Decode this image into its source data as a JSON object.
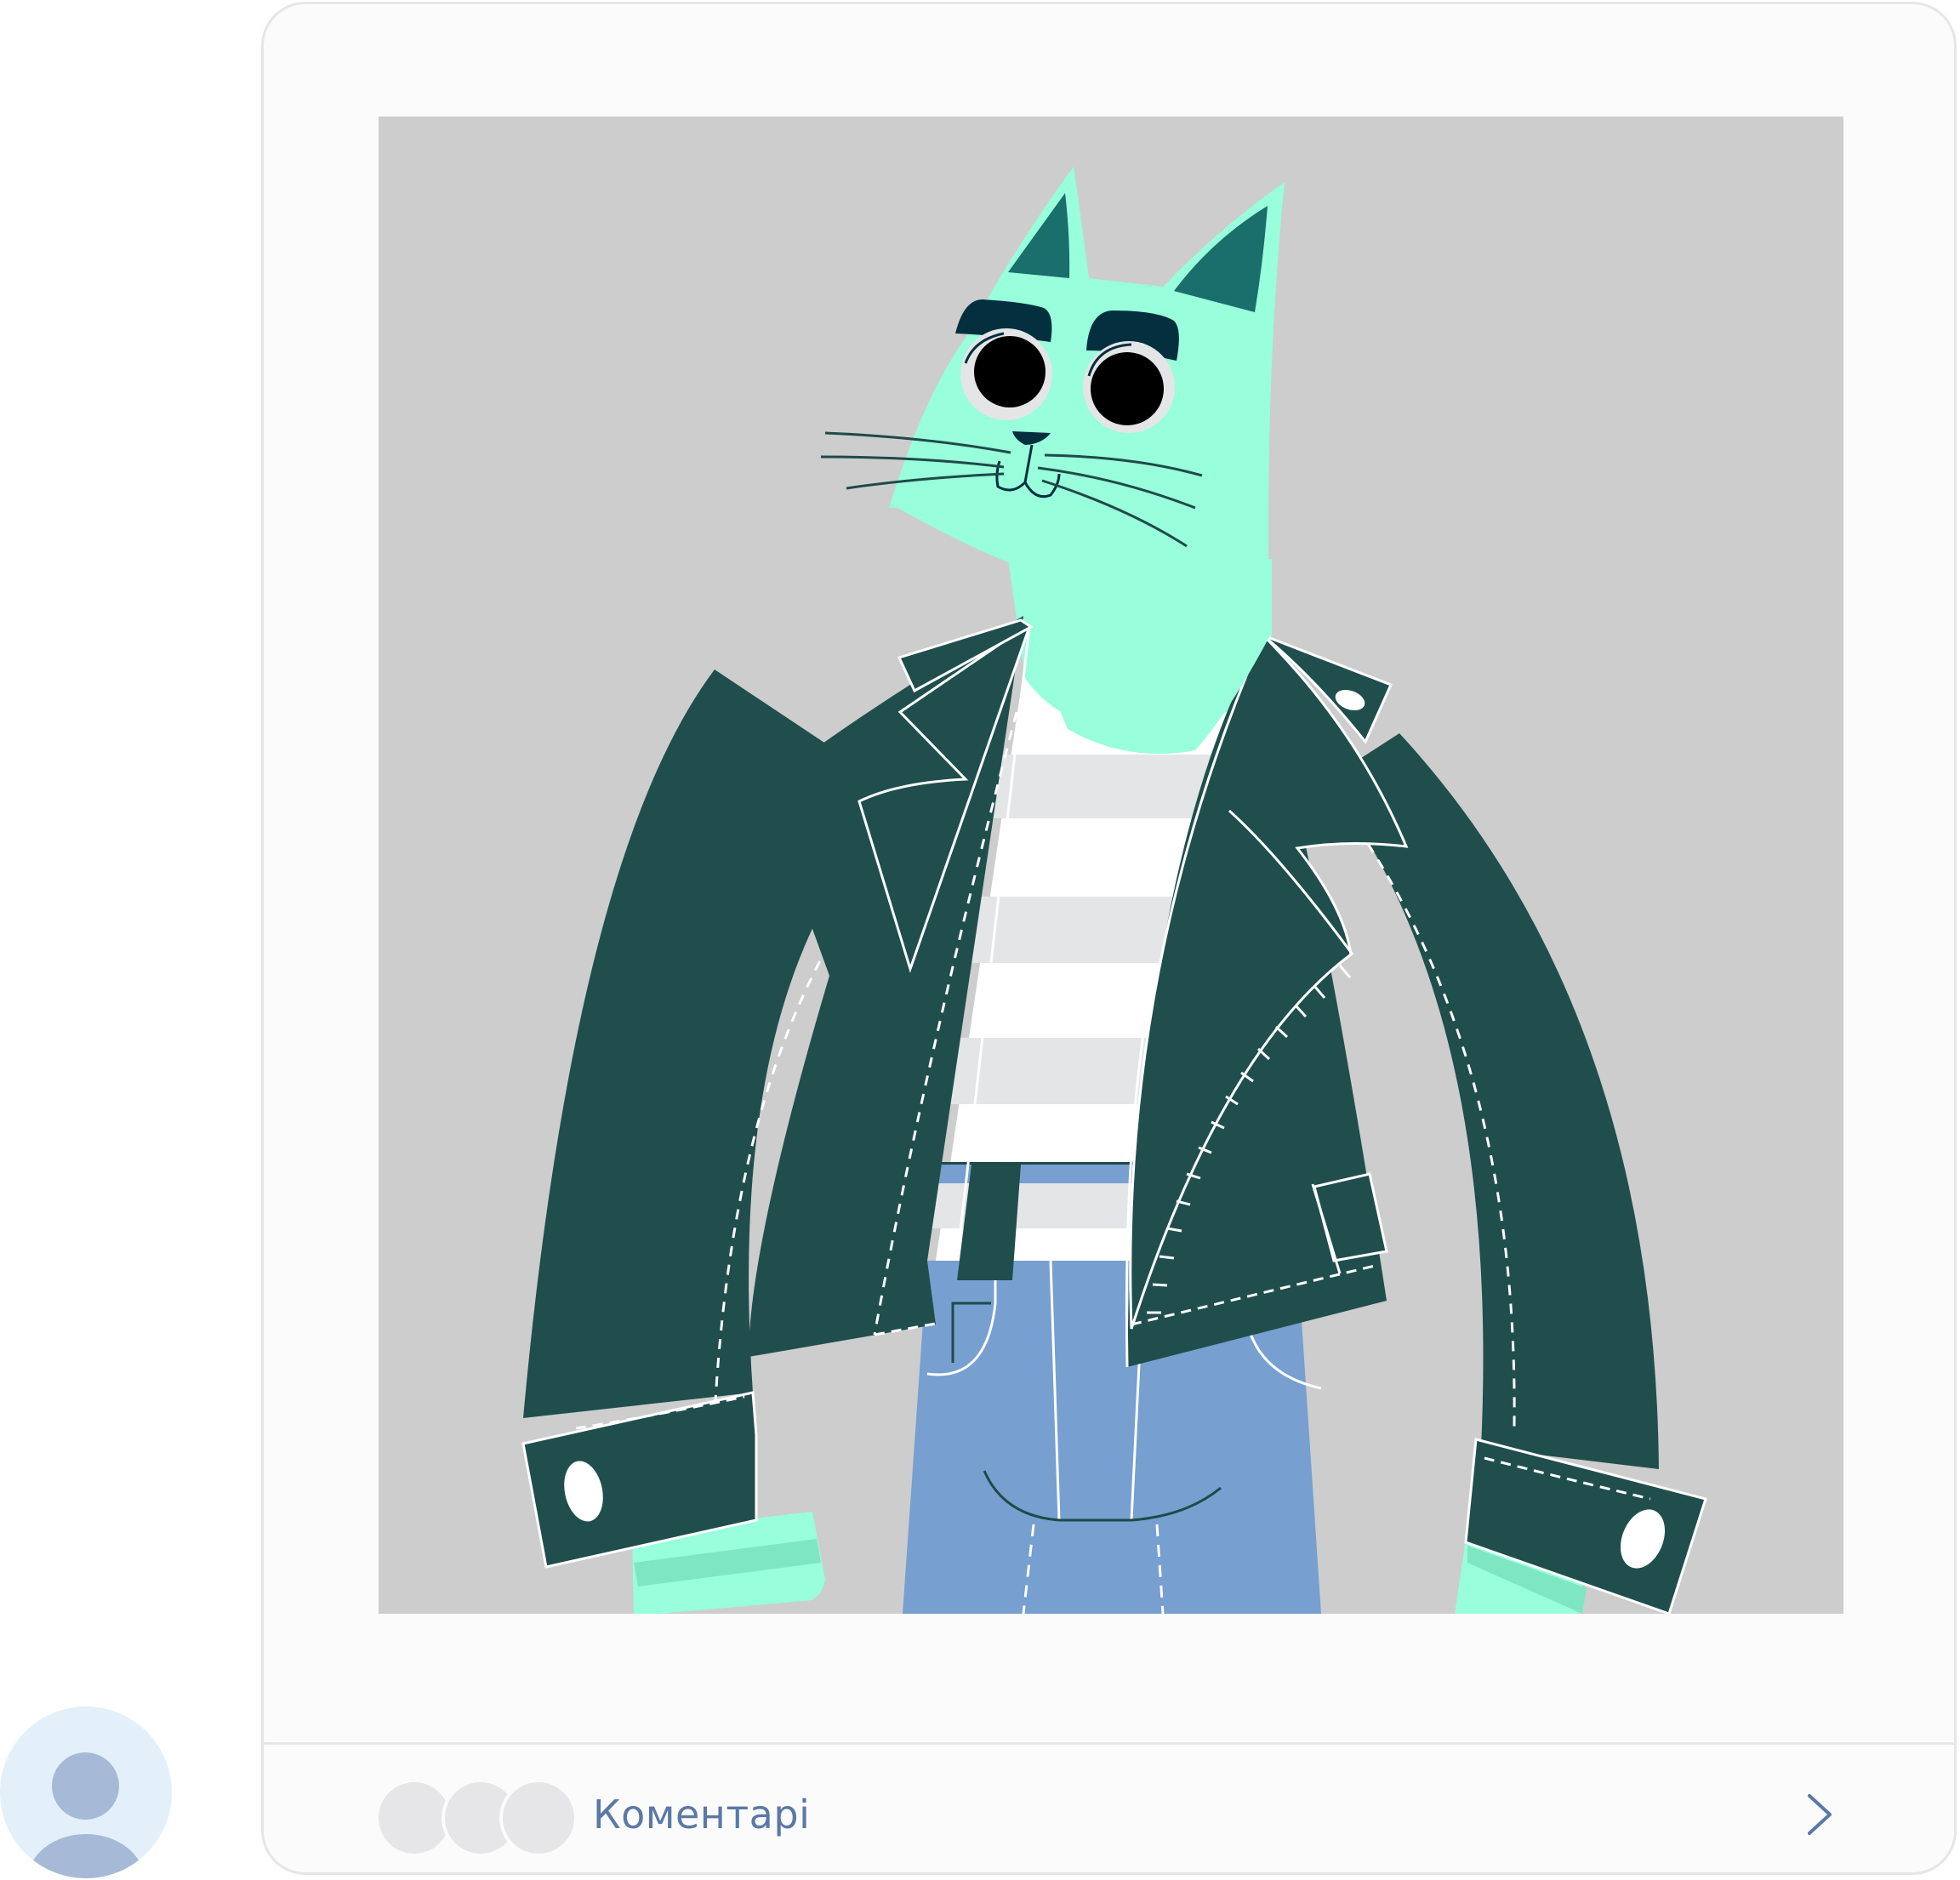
{
  "post": {
    "image_subject": "cat-in-leather-jacket-illustration"
  },
  "comments_bar": {
    "label": "Коментарі",
    "avatar_count": 3,
    "arrow_icon": "chevron-right-icon"
  },
  "profile": {
    "icon": "user-avatar-icon"
  },
  "colors": {
    "card_bg": "#fbfbfb",
    "card_border": "#e6e6e8",
    "photo_bg": "#cdcdcd",
    "cat_fur": "#98fedb",
    "ear_inner": "#1a6e6c",
    "jacket": "#204e4d",
    "stripe": "#e4e5e7",
    "jeans": "#779fcf",
    "label": "#5b78a6",
    "avatar_bg": "#e4f0f9",
    "avatar_fg": "#a6bad8"
  }
}
